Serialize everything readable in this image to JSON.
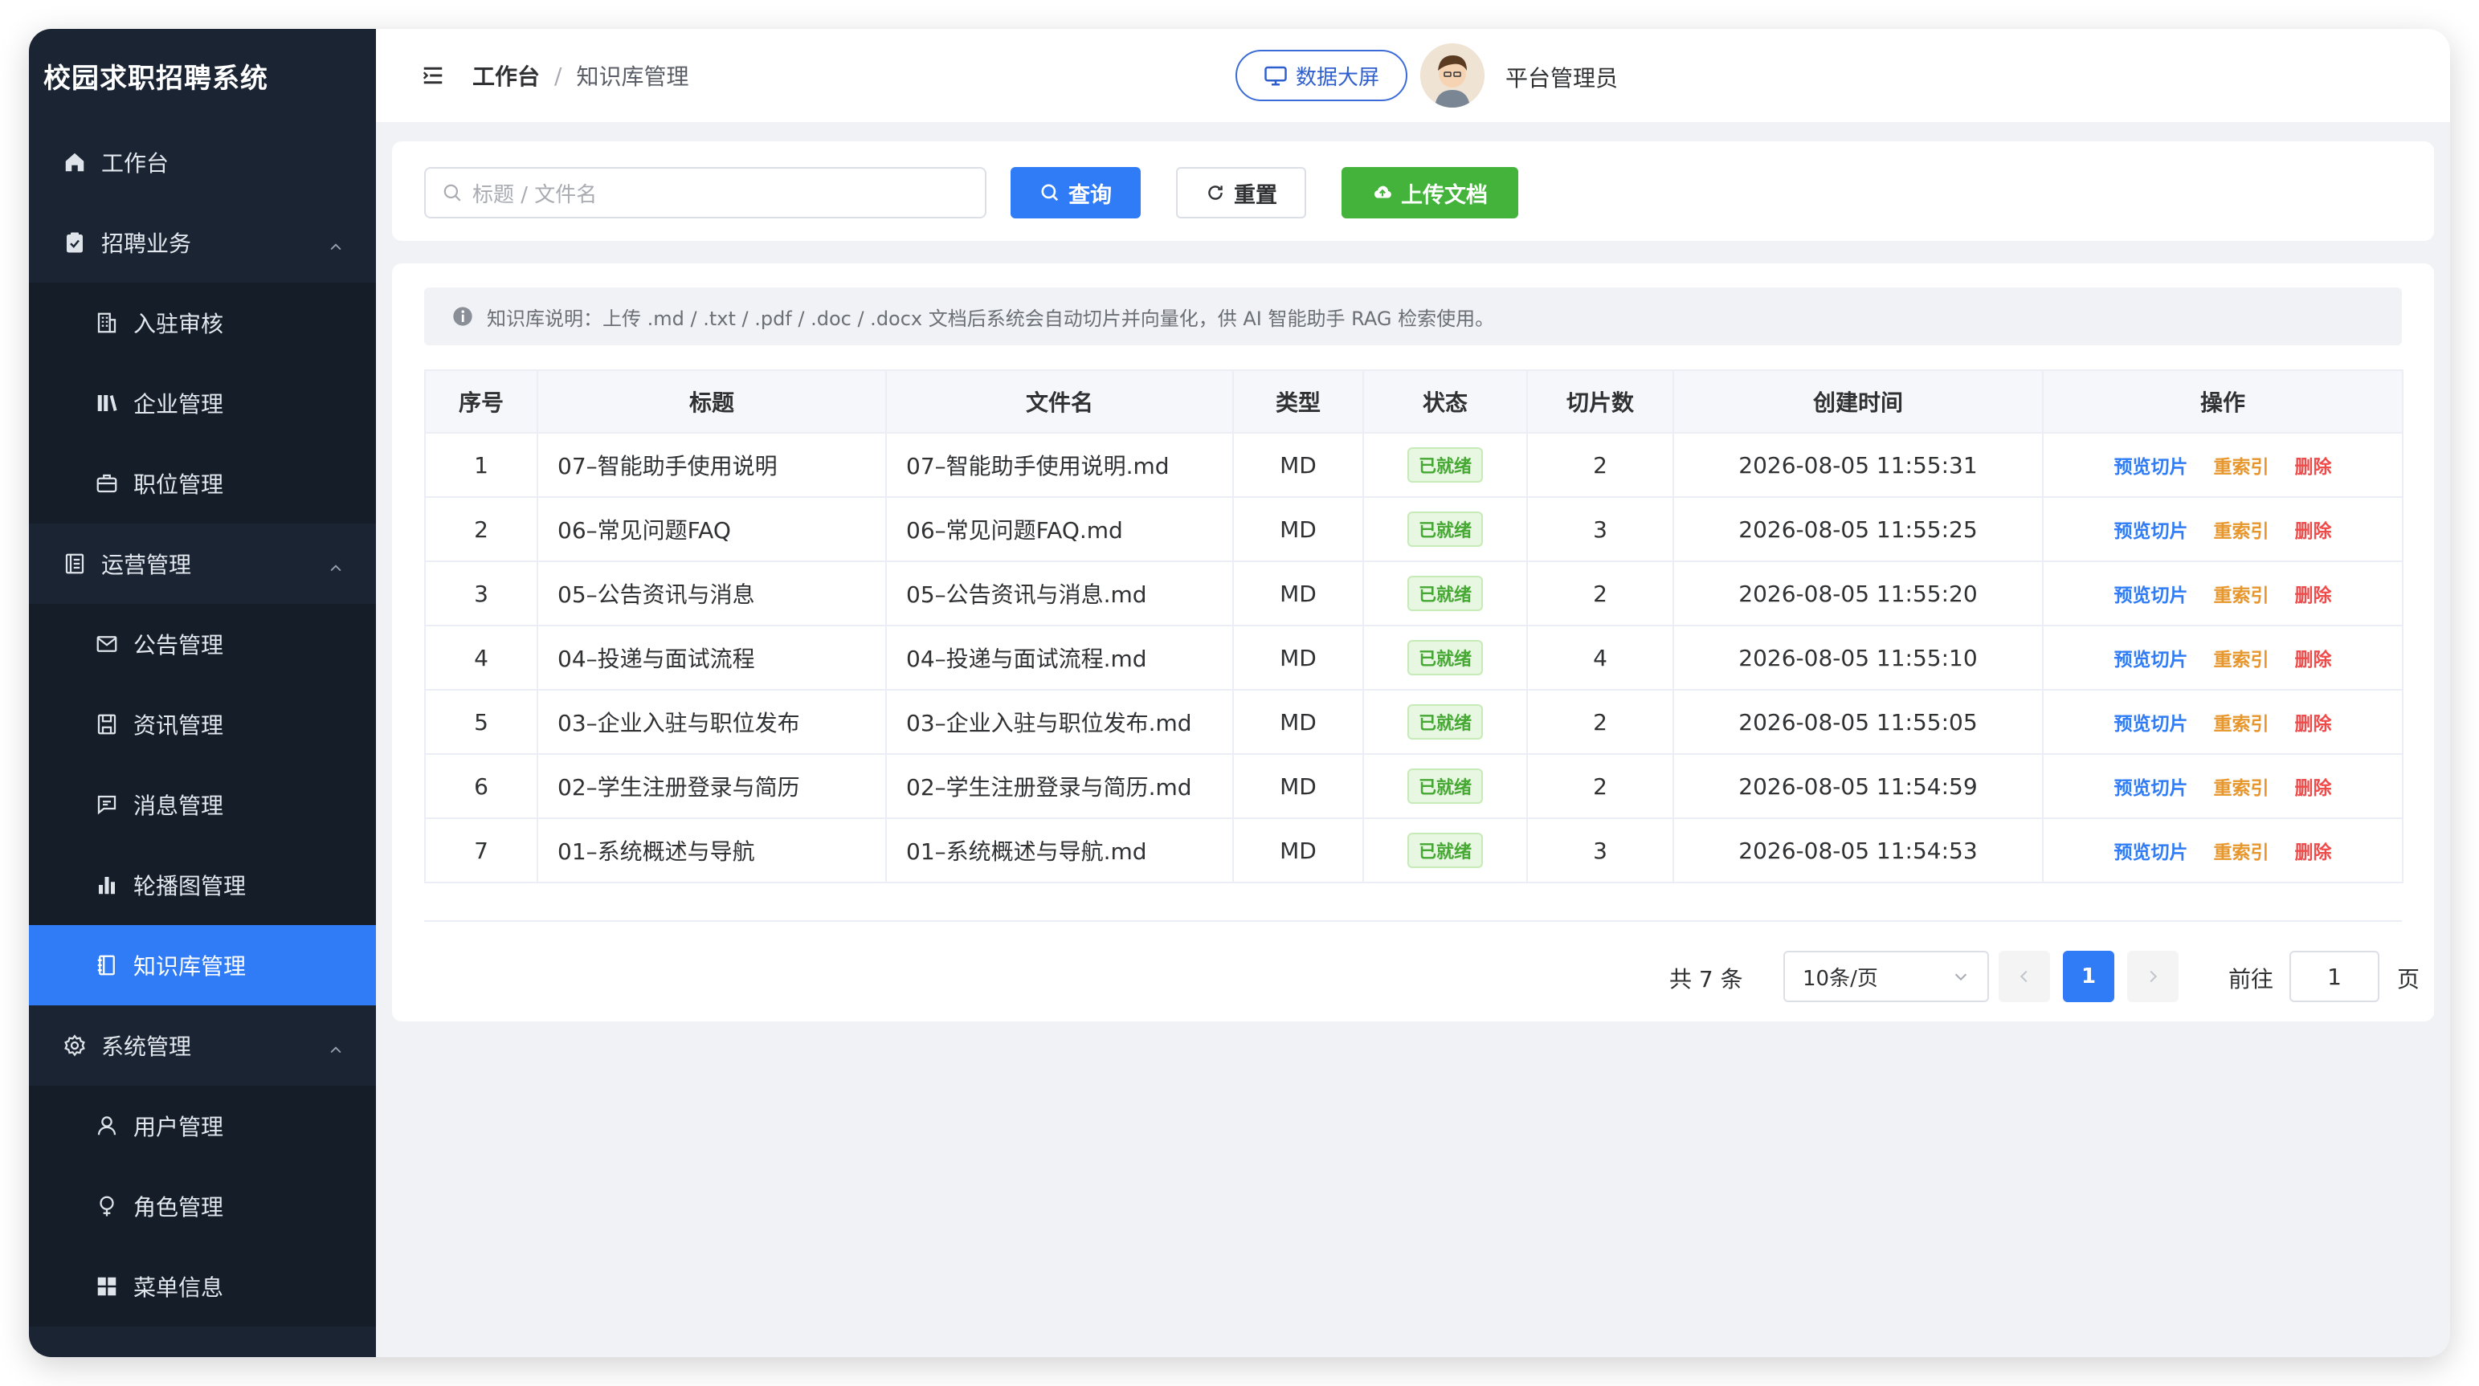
{
  "app": {
    "title": "校园求职招聘系统"
  },
  "sidebar": {
    "items": [
      {
        "label": "工作台",
        "icon": "home-icon",
        "level": "top"
      },
      {
        "label": "招聘业务",
        "icon": "clipboard-check-icon",
        "level": "top",
        "expanded": true
      },
      {
        "label": "入驻审核",
        "icon": "building-icon",
        "level": "sub"
      },
      {
        "label": "企业管理",
        "icon": "library-icon",
        "level": "sub"
      },
      {
        "label": "职位管理",
        "icon": "briefcase-icon",
        "level": "sub"
      },
      {
        "label": "运营管理",
        "icon": "document-list-icon",
        "level": "top",
        "expanded": true
      },
      {
        "label": "公告管理",
        "icon": "mail-icon",
        "level": "sub"
      },
      {
        "label": "资讯管理",
        "icon": "save-icon",
        "level": "sub"
      },
      {
        "label": "消息管理",
        "icon": "message-icon",
        "level": "sub"
      },
      {
        "label": "轮播图管理",
        "icon": "bar-chart-icon",
        "level": "sub"
      },
      {
        "label": "知识库管理",
        "icon": "notebook-icon",
        "level": "sub",
        "active": true
      },
      {
        "label": "系统管理",
        "icon": "gear-icon",
        "level": "top",
        "expanded": true
      },
      {
        "label": "用户管理",
        "icon": "user-icon",
        "level": "sub"
      },
      {
        "label": "角色管理",
        "icon": "female-icon",
        "level": "sub"
      },
      {
        "label": "菜单信息",
        "icon": "grid-icon",
        "level": "sub"
      }
    ]
  },
  "header": {
    "breadcrumb": [
      "工作台",
      "知识库管理"
    ],
    "separator": "/",
    "screen_button": "数据大屏",
    "username": "平台管理员"
  },
  "search": {
    "placeholder": "标题 / 文件名",
    "query_label": "查询",
    "reset_label": "重置",
    "upload_label": "上传文档"
  },
  "notice": "知识库说明：上传 .md / .txt / .pdf / .doc / .docx 文档后系统会自动切片并向量化，供 AI 智能助手 RAG 检索使用。",
  "table": {
    "columns": [
      "序号",
      "标题",
      "文件名",
      "类型",
      "状态",
      "切片数",
      "创建时间",
      "操作"
    ],
    "actions": {
      "preview": "预览切片",
      "reindex": "重索引",
      "delete": "删除"
    },
    "rows": [
      {
        "index": "1",
        "title": "07–智能助手使用说明",
        "file": "07–智能助手使用说明.md",
        "type": "MD",
        "status": "已就绪",
        "chunks": "2",
        "created": "2026-08-05 11:55:31"
      },
      {
        "index": "2",
        "title": "06–常见问题FAQ",
        "file": "06–常见问题FAQ.md",
        "type": "MD",
        "status": "已就绪",
        "chunks": "3",
        "created": "2026-08-05 11:55:25"
      },
      {
        "index": "3",
        "title": "05–公告资讯与消息",
        "file": "05–公告资讯与消息.md",
        "type": "MD",
        "status": "已就绪",
        "chunks": "2",
        "created": "2026-08-05 11:55:20"
      },
      {
        "index": "4",
        "title": "04–投递与面试流程",
        "file": "04–投递与面试流程.md",
        "type": "MD",
        "status": "已就绪",
        "chunks": "4",
        "created": "2026-08-05 11:55:10"
      },
      {
        "index": "5",
        "title": "03–企业入驻与职位发布",
        "file": "03–企业入驻与职位发布.md",
        "type": "MD",
        "status": "已就绪",
        "chunks": "2",
        "created": "2026-08-05 11:55:05"
      },
      {
        "index": "6",
        "title": "02–学生注册登录与简历",
        "file": "02–学生注册登录与简历.md",
        "type": "MD",
        "status": "已就绪",
        "chunks": "2",
        "created": "2026-08-05 11:54:59"
      },
      {
        "index": "7",
        "title": "01–系统概述与导航",
        "file": "01–系统概述与导航.md",
        "type": "MD",
        "status": "已就绪",
        "chunks": "3",
        "created": "2026-08-05 11:54:53"
      }
    ]
  },
  "pagination": {
    "total_text": "共 7 条",
    "page_size": "10条/页",
    "current_page": "1",
    "goto_label": "前往",
    "goto_value": "1",
    "goto_unit": "页"
  },
  "colors": {
    "sidebar_bg": "#1b2433",
    "active": "#2f7cf6",
    "success": "#44b33c",
    "warning": "#e6962b",
    "danger": "#ef4b4b"
  }
}
